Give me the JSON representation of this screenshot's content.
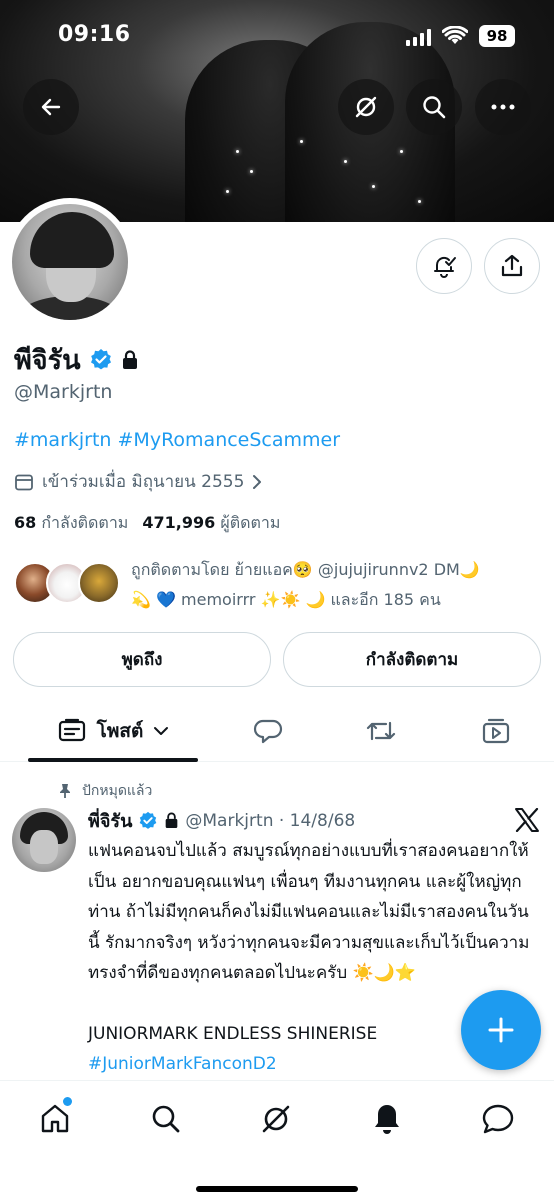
{
  "status_bar": {
    "time": "09:16",
    "battery": "98"
  },
  "profile": {
    "name": "พีจิรัน",
    "handle": "@Markjrtn",
    "bio_tags": "#markjrtn #MyRomanceScammer",
    "joined": "เข้าร่วมเมื่อ มิถุนายน 2555",
    "following_count": "68",
    "following_label": "กำลังติดตาม",
    "followers_count": "471,996",
    "followers_label": "ผู้ติดตาม",
    "followed_by_line1": "ถูกติดตามโดย ย้ายแอค🥺 @jujujirunnv2 DM🌙",
    "followed_by_line2": "💫 💙  memoirrr ✨☀️ 🌙 และอีก 185 คน"
  },
  "actions": {
    "mention": "พูดถึง",
    "following": "กำลังติดตาม"
  },
  "tabs": {
    "posts": "โพสต์"
  },
  "pinned_post": {
    "pinned_label": "ปักหมุดแล้ว",
    "author": "พี่จิรัน",
    "handle_date": "@Markjrtn · 14/8/68",
    "text": "แฟนคอนจบไปแล้ว สมบูรณ์ทุกอย่างแบบที่เราสองคนอยากให้เป็น อยากขอบคุณแฟนๆ เพื่อนๆ ทีมงานทุกคน และผู้ใหญ่ทุกท่าน ถ้าไม่มีทุกคนก็คงไม่มีแฟนคอนและไม่มีเราสองคนในวันนี้ รักมากจริงๆ หวังว่าทุกคนจะมีความสุขและเก็บไว้เป็นความทรงจำที่ดีของทุกคนตลอดไปนะครับ ☀️🌙⭐",
    "line2": "JUNIORMARK ENDLESS SHINERISE",
    "hashtag": "#JuniorMarkFanconD2"
  },
  "colors": {
    "accent": "#1d9bf0",
    "secondary_text": "#536471",
    "border": "#cfd9de"
  }
}
